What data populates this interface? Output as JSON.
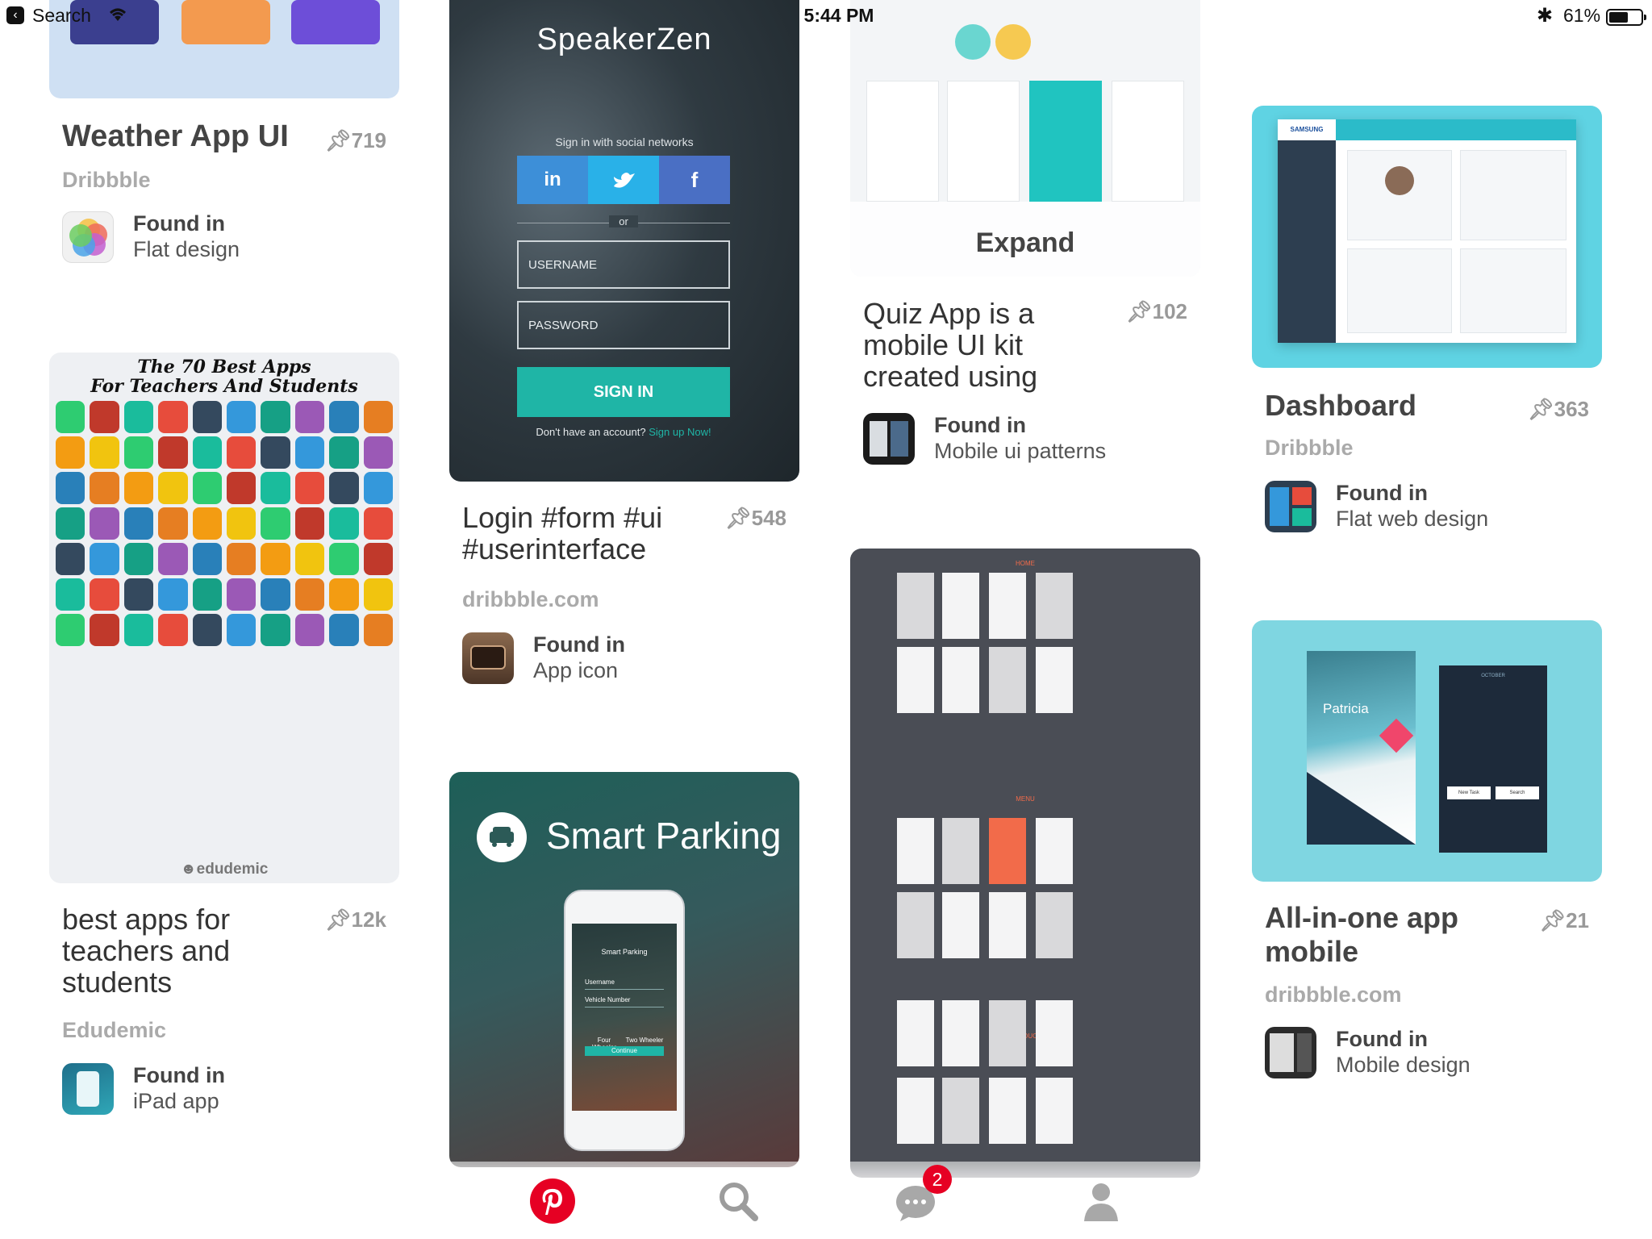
{
  "status_bar": {
    "back_label": "Search",
    "time": "5:44 PM",
    "battery_percent": "61%",
    "battery_level": 0.61
  },
  "cards": {
    "weather": {
      "title": "Weather App UI",
      "saves": "719",
      "source": "Dribbble",
      "found_in_label": "Found in",
      "board": "Flat design"
    },
    "teachers": {
      "image_title_line1": "The 70 Best Apps",
      "image_title_line2": "For Teachers And Students",
      "image_brand": "edudemic",
      "title": "best apps for teachers and students",
      "saves": "12k",
      "source": "Edudemic",
      "found_in_label": "Found in",
      "board": "iPad app"
    },
    "login": {
      "image_brand": "SpeakerZen",
      "image_social_text": "Sign in with social networks",
      "image_or": "or",
      "image_username": "USERNAME",
      "image_password": "PASSWORD",
      "image_signin": "SIGN IN",
      "image_no_account": "Don't have an account?",
      "image_signup": "Sign up Now!",
      "title": "Login #form #ui #userinterface",
      "saves": "548",
      "source": "dribbble.com",
      "found_in_label": "Found in",
      "board": "App icon"
    },
    "parking": {
      "image_title": "Smart Parking",
      "image_phone_title": "Smart Parking",
      "image_field_username": "Username",
      "image_field_vehicle": "Vehicle Number",
      "image_four_wheeler": "Four Wheeler",
      "image_two_wheeler": "Two Wheeler",
      "image_continue": "Continue"
    },
    "quiz": {
      "expand_label": "Expand",
      "title": "Quiz App is a mobile UI kit created using Ske…",
      "saves": "102",
      "found_in_label": "Found in",
      "board": "Mobile ui patterns"
    },
    "wireframes": {
      "section_home": "HOME",
      "section_menu": "MENU",
      "section_product": "PRODUCT"
    },
    "dashboard": {
      "image_brand": "SAMSUNG",
      "title": "Dashboard",
      "saves": "363",
      "source": "Dribbble",
      "found_in_label": "Found in",
      "board": "Flat web design"
    },
    "allinone": {
      "image_name": "Patricia",
      "image_month": "OCTOBER",
      "image_new_task": "New Task",
      "image_search": "Search",
      "title": "All-in-one app mobile",
      "saves": "21",
      "source": "dribbble.com",
      "found_in_label": "Found in",
      "board": "Mobile design"
    }
  },
  "tabbar": {
    "notification_count": "2",
    "accent": "#e60023"
  },
  "colors": {
    "text_dark": "#333333",
    "text_muted": "#aaaaaa",
    "teal": "#1fb5a6",
    "dashboard_bg": "#5fd3e3",
    "wireframe_bg": "#4a4d55"
  }
}
